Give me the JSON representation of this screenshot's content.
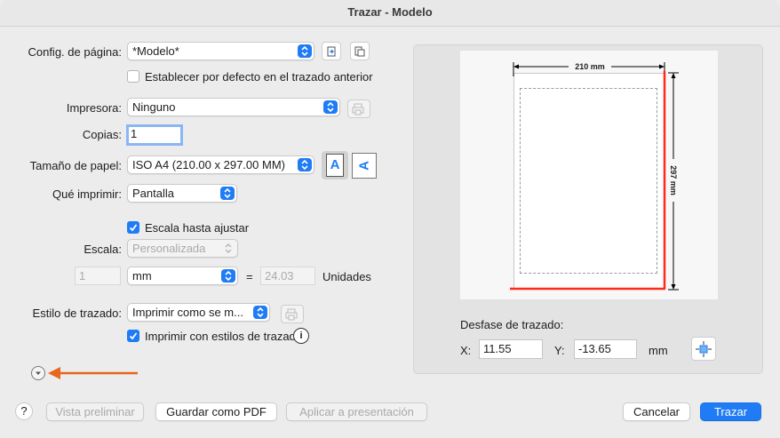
{
  "window": {
    "title": "Trazar - Modelo"
  },
  "page_setup": {
    "label": "Config. de página:",
    "value": "*Modelo*",
    "default_checkbox_label": "Establecer por defecto en el trazado anterior",
    "default_checked": false
  },
  "printer": {
    "label": "Impresora:",
    "value": "Ninguno"
  },
  "copies": {
    "label": "Copias:",
    "value": "1"
  },
  "paper": {
    "label": "Tamaño de papel:",
    "value": "ISO A4 (210.00 x 297.00 MM)",
    "portrait_icon": "A",
    "landscape_icon": "A"
  },
  "what_to_print": {
    "label": "Qué imprimir:",
    "value": "Pantalla"
  },
  "scale": {
    "fit_label": "Escala hasta ajustar",
    "fit_checked": true,
    "label": "Escala:",
    "value": "Personalizada",
    "left_value": "1",
    "unit": "mm",
    "equals": "=",
    "right_value": "24.03",
    "units_label": "Unidades"
  },
  "plot_style": {
    "label": "Estilo de trazado:",
    "value": "Imprimir como se m...",
    "with_styles_label": "Imprimir con estilos de trazado",
    "with_styles_checked": true
  },
  "preview": {
    "width_label": "210 mm",
    "height_label": "297 mm"
  },
  "offset": {
    "title": "Desfase de trazado:",
    "x_label": "X:",
    "x_value": "11.55",
    "y_label": "Y:",
    "y_value": "-13.65",
    "unit": "mm"
  },
  "buttons": {
    "help": "?",
    "preview": "Vista preliminar",
    "save_pdf": "Guardar como PDF",
    "apply_layout": "Aplicar a presentación",
    "cancel": "Cancelar",
    "plot": "Trazar"
  },
  "colors": {
    "accent": "#1f7cf5",
    "arrow": "#e8661d",
    "margin_line": "#ff2a1a"
  }
}
